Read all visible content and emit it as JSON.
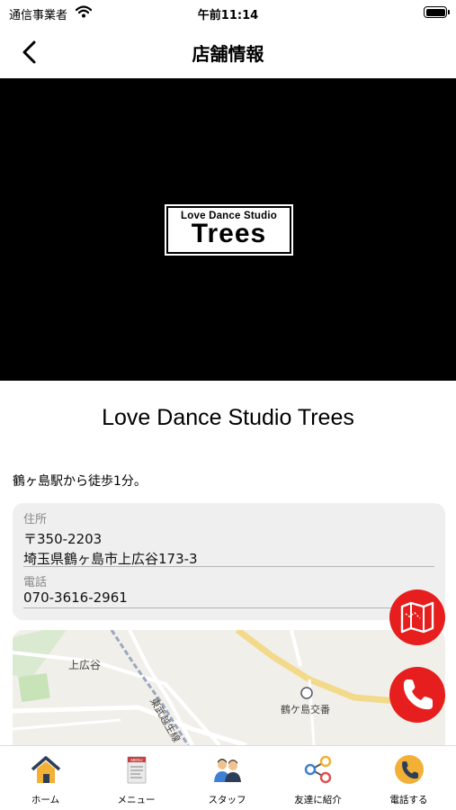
{
  "status_bar": {
    "carrier": "通信事業者",
    "time": "午前11:14"
  },
  "nav": {
    "title": "店舗情報"
  },
  "hero": {
    "logo_line1": "Love Dance Studio",
    "logo_line2": "Trees"
  },
  "store": {
    "name": "Love Dance Studio Trees",
    "access": "鶴ヶ島駅から徒歩1分。",
    "address_label": "住所",
    "postal_code": "〒350-2203",
    "address": "埼玉県鶴ヶ島市上広谷173-3",
    "phone_label": "電話",
    "phone": "070-3616-2961"
  },
  "map": {
    "labels": [
      "上広谷",
      "東武越生線",
      "鶴ケ島交番"
    ]
  },
  "fabs": {
    "map_icon": "folded-map-icon",
    "call_icon": "phone-icon",
    "color": "#e61e1e"
  },
  "tabs": [
    {
      "label": "ホーム",
      "icon": "home-icon"
    },
    {
      "label": "メニュー",
      "icon": "menu-board-icon",
      "badge_text": "MENU"
    },
    {
      "label": "スタッフ",
      "icon": "staff-icon"
    },
    {
      "label": "友達に紹介",
      "icon": "share-icon"
    },
    {
      "label": "電話する",
      "icon": "phone-icon"
    }
  ]
}
